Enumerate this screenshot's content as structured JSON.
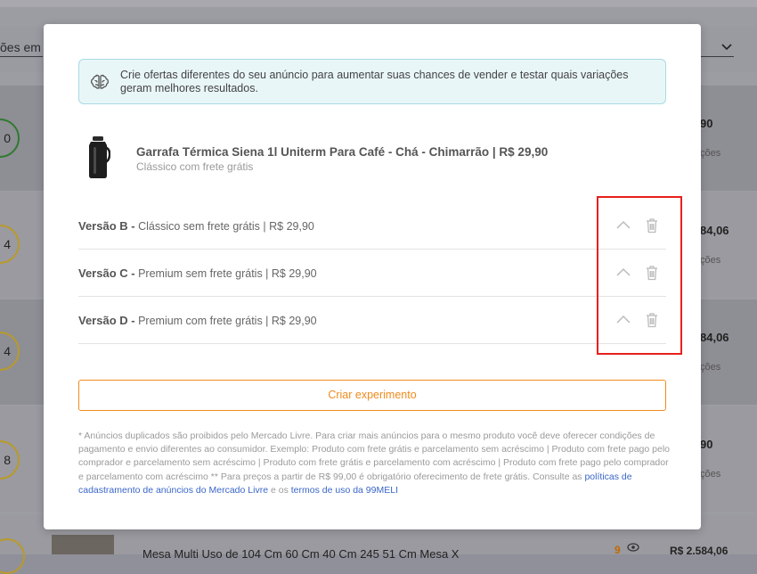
{
  "background": {
    "filter_text": "ões em",
    "rows": [
      {
        "circle": "0",
        "price": "90",
        "sub": "ções"
      },
      {
        "circle": "4",
        "price": "84,06",
        "sub": "ções"
      },
      {
        "circle": "4",
        "price": "84,06",
        "sub": "ções"
      },
      {
        "circle": "8",
        "price": "90",
        "sub": "ções"
      }
    ],
    "bottom": {
      "title": "Mesa Multi Uso de 104 Cm 60 Cm 40 Cm 245 51 Cm Mesa X",
      "count": "9",
      "price": "R$ 2.584,06"
    }
  },
  "modal": {
    "info_text": "Crie ofertas diferentes do seu anúncio para aumentar suas chances de vender e testar quais variações geram melhores resultados.",
    "product": {
      "title": "Garrafa Térmica Siena 1l Uniterm Para Café - Chá - Chimarrão | R$ 29,90",
      "subtitle": "Clássico com frete grátis"
    },
    "versions": [
      {
        "label": "Versão B -",
        "detail": "Clássico sem frete grátis | R$ 29,90"
      },
      {
        "label": "Versão C -",
        "detail": "Premium sem frete grátis | R$ 29,90"
      },
      {
        "label": "Versão D -",
        "detail": "Premium com frete grátis | R$ 29,90"
      }
    ],
    "create_button": "Criar experimento",
    "footnote": {
      "text": "* Anúncios duplicados são proibidos pelo Mercado Livre. Para criar mais anúncios para o mesmo produto você deve oferecer condições de pagamento e envio diferentes ao consumidor. Exemplo: Produto com frete grátis e parcelamento sem acréscimo | Produto com frete pago pelo comprador e parcelamento sem acréscimo | Produto com frete grátis e parcelamento com acréscimo | Produto com frete pago pelo comprador e parcelamento com acréscimo ** Para preços a partir de R$ 99,00 é obrigatório oferecimento de frete grátis. Consulte as",
      "link1": "políticas de cadastramento de anúncios do Mercado Livre",
      "middle": "e os",
      "link2": "termos de uso da 99MELI"
    }
  },
  "icons": {
    "info": "brain-icon",
    "version_toggle": "chevron-up-icon",
    "version_delete": "trash-icon"
  },
  "colors": {
    "accent": "#f08b1c",
    "highlight": "#e8201c",
    "info_bg": "#e9f6f8",
    "link": "#3a66c8"
  }
}
